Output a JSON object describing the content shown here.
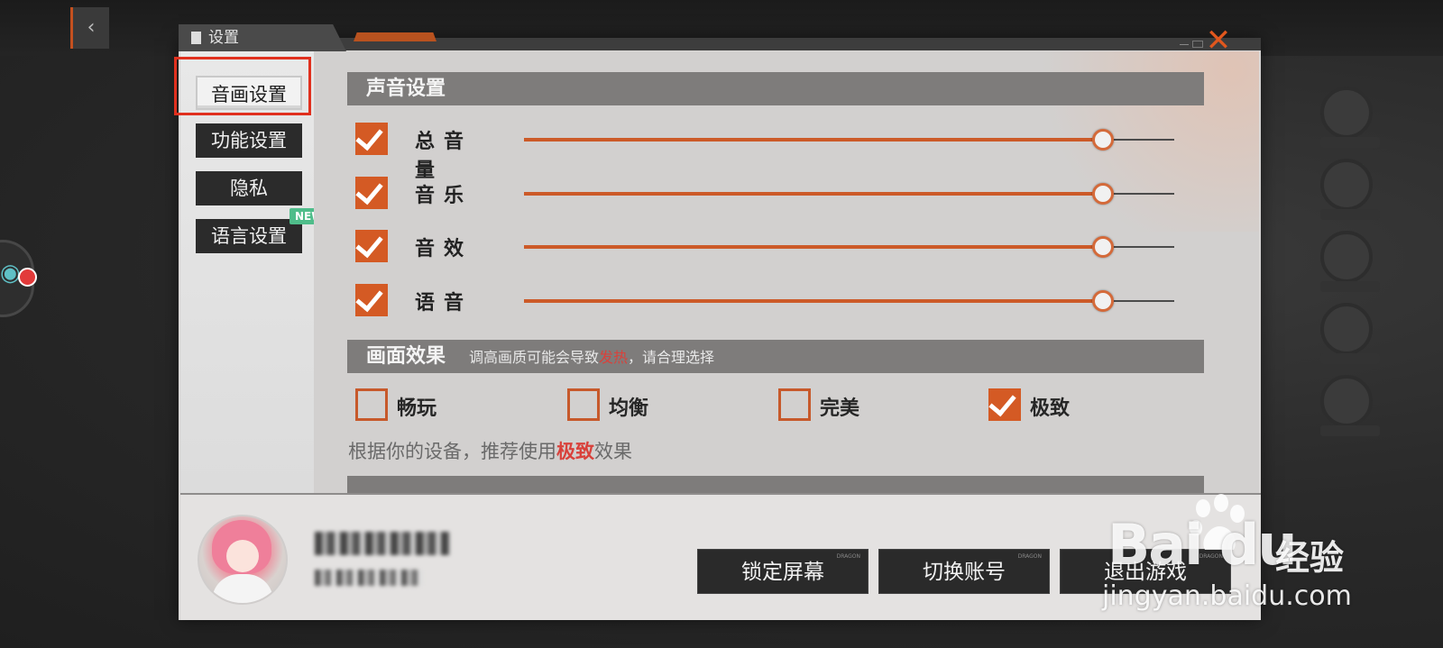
{
  "dialog": {
    "title": "设置",
    "close_glyph": "✕"
  },
  "sidebar": {
    "items": [
      {
        "label": "音画设置",
        "active": true
      },
      {
        "label": "功能设置",
        "active": false
      },
      {
        "label": "隐私",
        "active": false
      },
      {
        "label": "语言设置",
        "active": false,
        "badge": "NEW"
      }
    ]
  },
  "sound": {
    "header": "声音设置",
    "rows": [
      {
        "label": "总音量",
        "checked": true,
        "level": 0.89
      },
      {
        "label": "音乐",
        "checked": true,
        "level": 0.89
      },
      {
        "label": "音效",
        "checked": true,
        "level": 0.89
      },
      {
        "label": "语音",
        "checked": true,
        "level": 0.89
      }
    ]
  },
  "graphics": {
    "header": "画面效果",
    "subtitle_pre": "调高画质可能会导致",
    "subtitle_warn": "发热",
    "subtitle_post": "，请合理选择",
    "options": [
      {
        "label": "畅玩",
        "checked": false
      },
      {
        "label": "均衡",
        "checked": false
      },
      {
        "label": "完美",
        "checked": false
      },
      {
        "label": "极致",
        "checked": true
      }
    ],
    "recommend_pre": "根据你的设备，推荐使用",
    "recommend_value": "极致",
    "recommend_post": "效果"
  },
  "footer": {
    "buttons": {
      "lock": "锁定屏幕",
      "switch": "切换账号",
      "exit": "退出游戏"
    },
    "button_tag": "DRAGON"
  },
  "watermark": {
    "brand": "Bai  du",
    "cn": "经验",
    "url": "jingyan.baidu.com"
  },
  "colors": {
    "accent": "#d45a24",
    "warn": "#d9413b",
    "new_badge": "#4fbd8a",
    "highlight": "#e0301e"
  }
}
